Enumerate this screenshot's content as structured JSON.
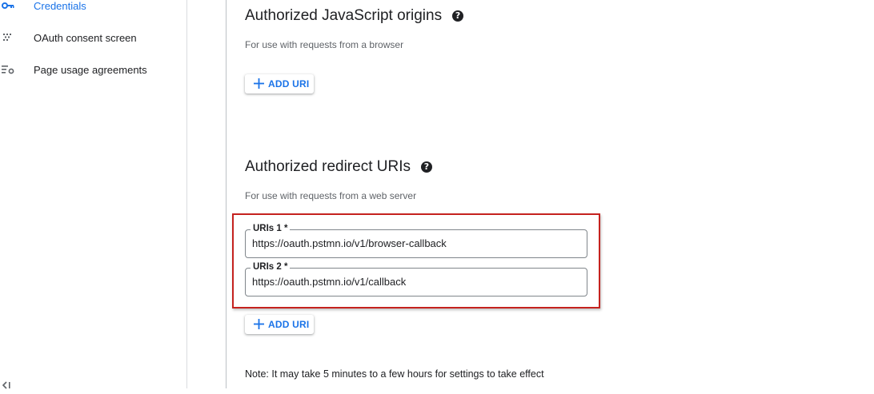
{
  "sidebar": {
    "items": [
      {
        "label": "Credentials",
        "icon": "key-icon",
        "active": true
      },
      {
        "label": "OAuth consent screen",
        "icon": "consent-icon",
        "active": false
      },
      {
        "label": "Page usage agreements",
        "icon": "settings-list-icon",
        "active": false
      }
    ],
    "collapse_icon": "collapse-icon"
  },
  "js_origins": {
    "title": "Authorized JavaScript origins",
    "help": "?",
    "description": "For use with requests from a browser",
    "add_label": "ADD URI"
  },
  "redirect_uris": {
    "title": "Authorized redirect URIs",
    "help": "?",
    "description": "For use with requests from a web server",
    "fields": [
      {
        "label": "URIs 1 *",
        "value": "https://oauth.pstmn.io/v1/browser-callback"
      },
      {
        "label": "URIs 2 *",
        "value": "https://oauth.pstmn.io/v1/callback"
      }
    ],
    "add_label": "ADD URI"
  },
  "note": "Note: It may take 5 minutes to a few hours for settings to take effect",
  "colors": {
    "accent": "#1a73e8",
    "highlight": "#c5221f"
  }
}
